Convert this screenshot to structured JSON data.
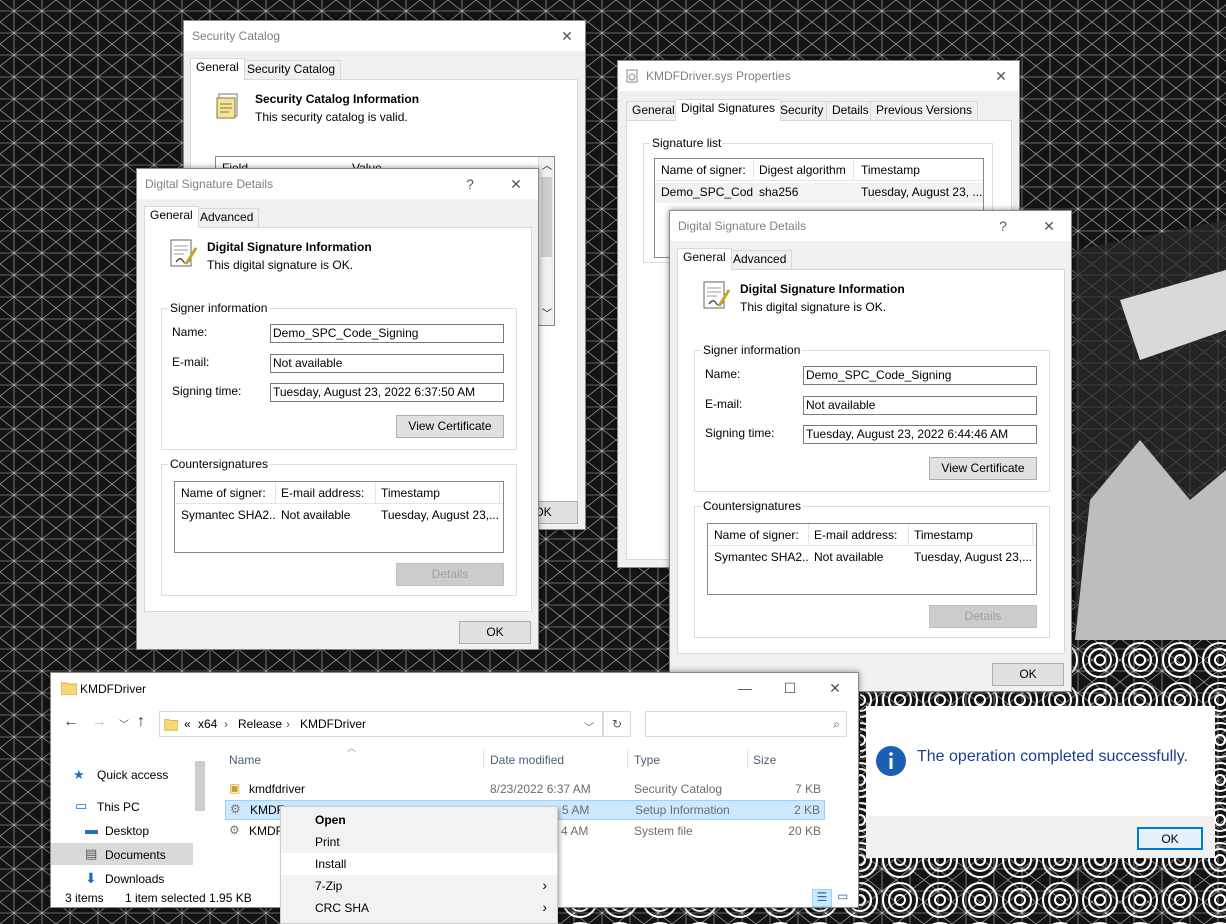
{
  "catalog_window": {
    "title": "Security Catalog",
    "close": "✕",
    "tabs": [
      "General",
      "Security Catalog"
    ],
    "heading": "Security Catalog Information",
    "status": "This security catalog is valid.",
    "columns": [
      "Field",
      "Value"
    ],
    "ok": "OK"
  },
  "sig_details_1": {
    "title": "Digital Signature Details",
    "help": "?",
    "close": "✕",
    "tabs": [
      "General",
      "Advanced"
    ],
    "heading": "Digital Signature Information",
    "status": "This digital signature is OK.",
    "signer_group": "Signer information",
    "name_label": "Name:",
    "name_value": "Demo_SPC_Code_Signing",
    "email_label": "E-mail:",
    "email_value": "Not available",
    "time_label": "Signing time:",
    "time_value": "Tuesday, August 23, 2022 6:37:50 AM",
    "view_cert": "View Certificate",
    "counter_group": "Countersignatures",
    "counter_cols": [
      "Name of signer:",
      "E-mail address:",
      "Timestamp"
    ],
    "counter_row": [
      "Symantec SHA2...",
      "Not available",
      "Tuesday, August 23,..."
    ],
    "details": "Details",
    "ok": "OK"
  },
  "props_window": {
    "title": "KMDFDriver.sys Properties",
    "close": "✕",
    "tabs": [
      "General",
      "Digital Signatures",
      "Security",
      "Details",
      "Previous Versions"
    ],
    "sig_list_label": "Signature list",
    "cols": [
      "Name of signer:",
      "Digest algorithm",
      "Timestamp"
    ],
    "row": [
      "Demo_SPC_Cod...",
      "sha256",
      "Tuesday, August 23, ..."
    ]
  },
  "sig_details_2": {
    "title": "Digital Signature Details",
    "help": "?",
    "close": "✕",
    "tabs": [
      "General",
      "Advanced"
    ],
    "heading": "Digital Signature Information",
    "status": "This digital signature is OK.",
    "signer_group": "Signer information",
    "name_label": "Name:",
    "name_value": "Demo_SPC_Code_Signing",
    "email_label": "E-mail:",
    "email_value": "Not available",
    "time_label": "Signing time:",
    "time_value": "Tuesday, August 23, 2022 6:44:46 AM",
    "view_cert": "View Certificate",
    "counter_group": "Countersignatures",
    "counter_cols": [
      "Name of signer:",
      "E-mail address:",
      "Timestamp"
    ],
    "counter_row": [
      "Symantec SHA2...",
      "Not available",
      "Tuesday, August 23,..."
    ],
    "details": "Details",
    "ok": "OK"
  },
  "explorer": {
    "title": "KMDFDriver",
    "minimize": "—",
    "maximize": "☐",
    "close": "✕",
    "path_prefix": "«",
    "path": [
      "x64",
      "Release",
      "KMDFDriver"
    ],
    "nav": {
      "quick_access": "Quick access",
      "this_pc": "This PC",
      "desktop": "Desktop",
      "documents": "Documents",
      "downloads": "Downloads"
    },
    "columns": [
      "Name",
      "Date modified",
      "Type",
      "Size"
    ],
    "files": [
      {
        "name": "kmdfdriver",
        "date": "8/23/2022 6:37 AM",
        "type": "Security Catalog",
        "size": "7 KB"
      },
      {
        "name": "KMDF",
        "date": "5 AM",
        "type": "Setup Information",
        "size": "2 KB"
      },
      {
        "name": "KMDF",
        "date": "4 AM",
        "type": "System file",
        "size": "20 KB"
      }
    ],
    "status_items": "3 items",
    "status_selected": "1 item selected  1.95 KB"
  },
  "context_menu": {
    "items": [
      "Open",
      "Print",
      "Install",
      "7-Zip",
      "CRC SHA"
    ]
  },
  "info_dialog": {
    "message": "The operation completed successfully.",
    "ok": "OK",
    "icon": "info-icon"
  },
  "colors": {
    "accent": "#0063b1",
    "selection": "#cce8ff",
    "info_blue": "#1a5fb4"
  }
}
